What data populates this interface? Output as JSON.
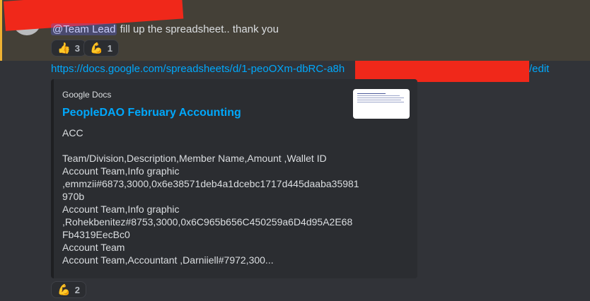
{
  "message": {
    "mention": "@Team Lead",
    "text": " fill up the spreadsheet.. thank you",
    "reactions": [
      {
        "icon": "thumbs-up-icon",
        "emoji": "👍",
        "count": "3"
      },
      {
        "icon": "flexed-biceps-icon",
        "emoji": "💪",
        "count": "1"
      }
    ]
  },
  "link": {
    "visible_text": "https://docs.google.com/spreadsheets/d/1-peoOXm-dbRC-a8h",
    "tail": "/edit"
  },
  "embed": {
    "provider": "Google Docs",
    "title": "PeopleDAO February Accounting",
    "description": "ACC\n\nTeam/Division,Description,Member Name,Amount ,Wallet ID\nAccount Team,Info graphic\n,emmzii#6873,3000,0x6e38571deb4a1dcebc1717d445daaba35981\n970b\nAccount Team,Info graphic\n,Rohekbenitez#8753,3000,0x6C965b656C450259a6D4d95A2E68\nFb4319EecBc0\nAccount Team\nAccount Team,Accountant ,Darniiell#7972,300...",
    "thumbnail_icon": "spreadsheet-thumbnail"
  },
  "bottom_reactions": [
    {
      "icon": "flexed-biceps-icon",
      "emoji": "💪",
      "count": "2"
    }
  ],
  "colors": {
    "background": "#313338",
    "mention_highlight": "#444037",
    "mention_bar": "#f0b232",
    "link": "#00a8fc",
    "redaction": "#f0281a"
  }
}
